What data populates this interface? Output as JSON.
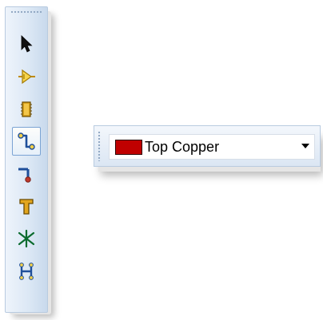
{
  "tools": [
    {
      "name": "select-tool",
      "icon": "arrow-pointer-icon",
      "active": false
    },
    {
      "name": "component-tool",
      "icon": "component-pin-icon",
      "active": false
    },
    {
      "name": "ic-package-tool",
      "icon": "ic-chip-icon",
      "active": false
    },
    {
      "name": "route-track-tool",
      "icon": "route-track-icon",
      "active": true
    },
    {
      "name": "pad-tool",
      "icon": "pad-pin-icon",
      "active": false
    },
    {
      "name": "text-tool",
      "icon": "text-t-icon",
      "active": false
    },
    {
      "name": "ratsnest-tool",
      "icon": "ratsnest-star-icon",
      "active": false
    },
    {
      "name": "connectivity-tool",
      "icon": "connectivity-h-icon",
      "active": false
    }
  ],
  "layer_selector": {
    "value": "Top Copper",
    "swatch_color": "#c00000"
  },
  "colors": {
    "accent": "#7ba3d4"
  }
}
